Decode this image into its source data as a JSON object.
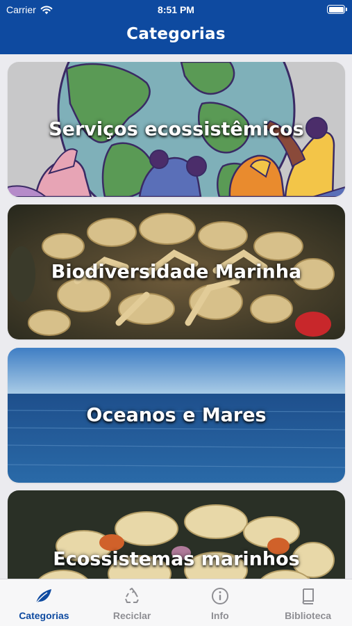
{
  "status_bar": {
    "carrier": "Carrier",
    "time": "8:51 PM"
  },
  "header": {
    "title": "Categorias"
  },
  "categories": [
    {
      "label": "Serviços ecossistêmicos",
      "image": "earth-hands-illustration"
    },
    {
      "label": "Biodiversidade Marinha",
      "image": "coral-reef-photo"
    },
    {
      "label": "Oceanos e Mares",
      "image": "ocean-horizon-photo"
    },
    {
      "label": "Ecossistemas marinhos",
      "image": "brain-coral-photo"
    }
  ],
  "tabs": [
    {
      "label": "Categorias",
      "icon": "leaf-icon",
      "active": true
    },
    {
      "label": "Reciclar",
      "icon": "recycle-icon",
      "active": false
    },
    {
      "label": "Info",
      "icon": "info-icon",
      "active": false
    },
    {
      "label": "Biblioteca",
      "icon": "book-icon",
      "active": false
    }
  ],
  "colors": {
    "brand": "#0e4aa0",
    "inactive": "#8e8e93",
    "background": "#ebebef"
  }
}
